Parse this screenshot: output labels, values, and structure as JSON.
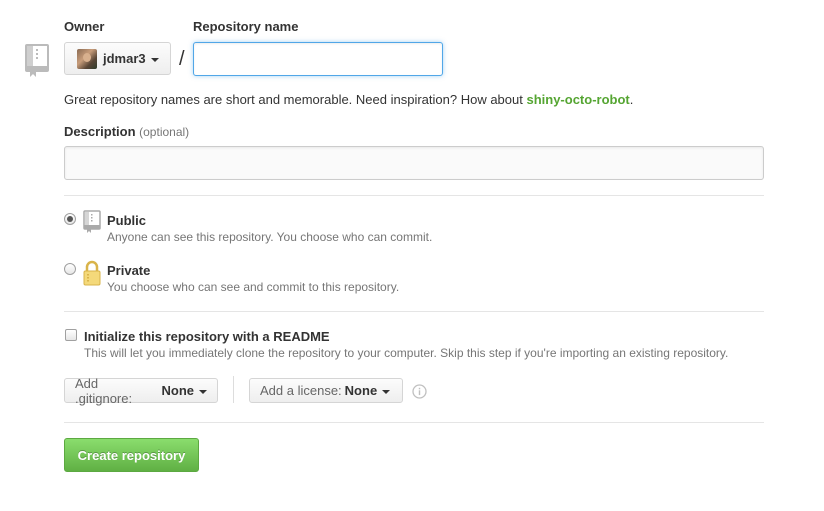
{
  "owner": {
    "label": "Owner",
    "username": "jdmar3"
  },
  "repository_name": {
    "label": "Repository name",
    "value": "",
    "separator": "/"
  },
  "hint": {
    "text": "Great repository names are short and memorable. Need inspiration? How about ",
    "suggestion": "shiny-octo-robot",
    "end": "."
  },
  "description": {
    "label": "Description",
    "optional_label": "(optional)",
    "value": ""
  },
  "visibility": {
    "options": [
      {
        "title": "Public",
        "description": "Anyone can see this repository. You choose who can commit.",
        "selected": true
      },
      {
        "title": "Private",
        "description": "You choose who can see and commit to this repository.",
        "selected": false
      }
    ]
  },
  "readme": {
    "title": "Initialize this repository with a README",
    "description": "This will let you immediately clone the repository to your computer. Skip this step if you're importing an existing repository.",
    "checked": false
  },
  "gitignore": {
    "label": "Add .gitignore:",
    "value": "None"
  },
  "license": {
    "label": "Add a license:",
    "value": "None"
  },
  "submit": {
    "label": "Create repository"
  },
  "colors": {
    "accent_green": "#55a532",
    "button_green": "#60b044",
    "focus_blue": "#51a7e8"
  },
  "icons": {
    "repo": "repo-icon",
    "public": "repo-icon",
    "private": "lock-icon",
    "info": "info-icon",
    "dropdown": "caret-down-icon"
  }
}
